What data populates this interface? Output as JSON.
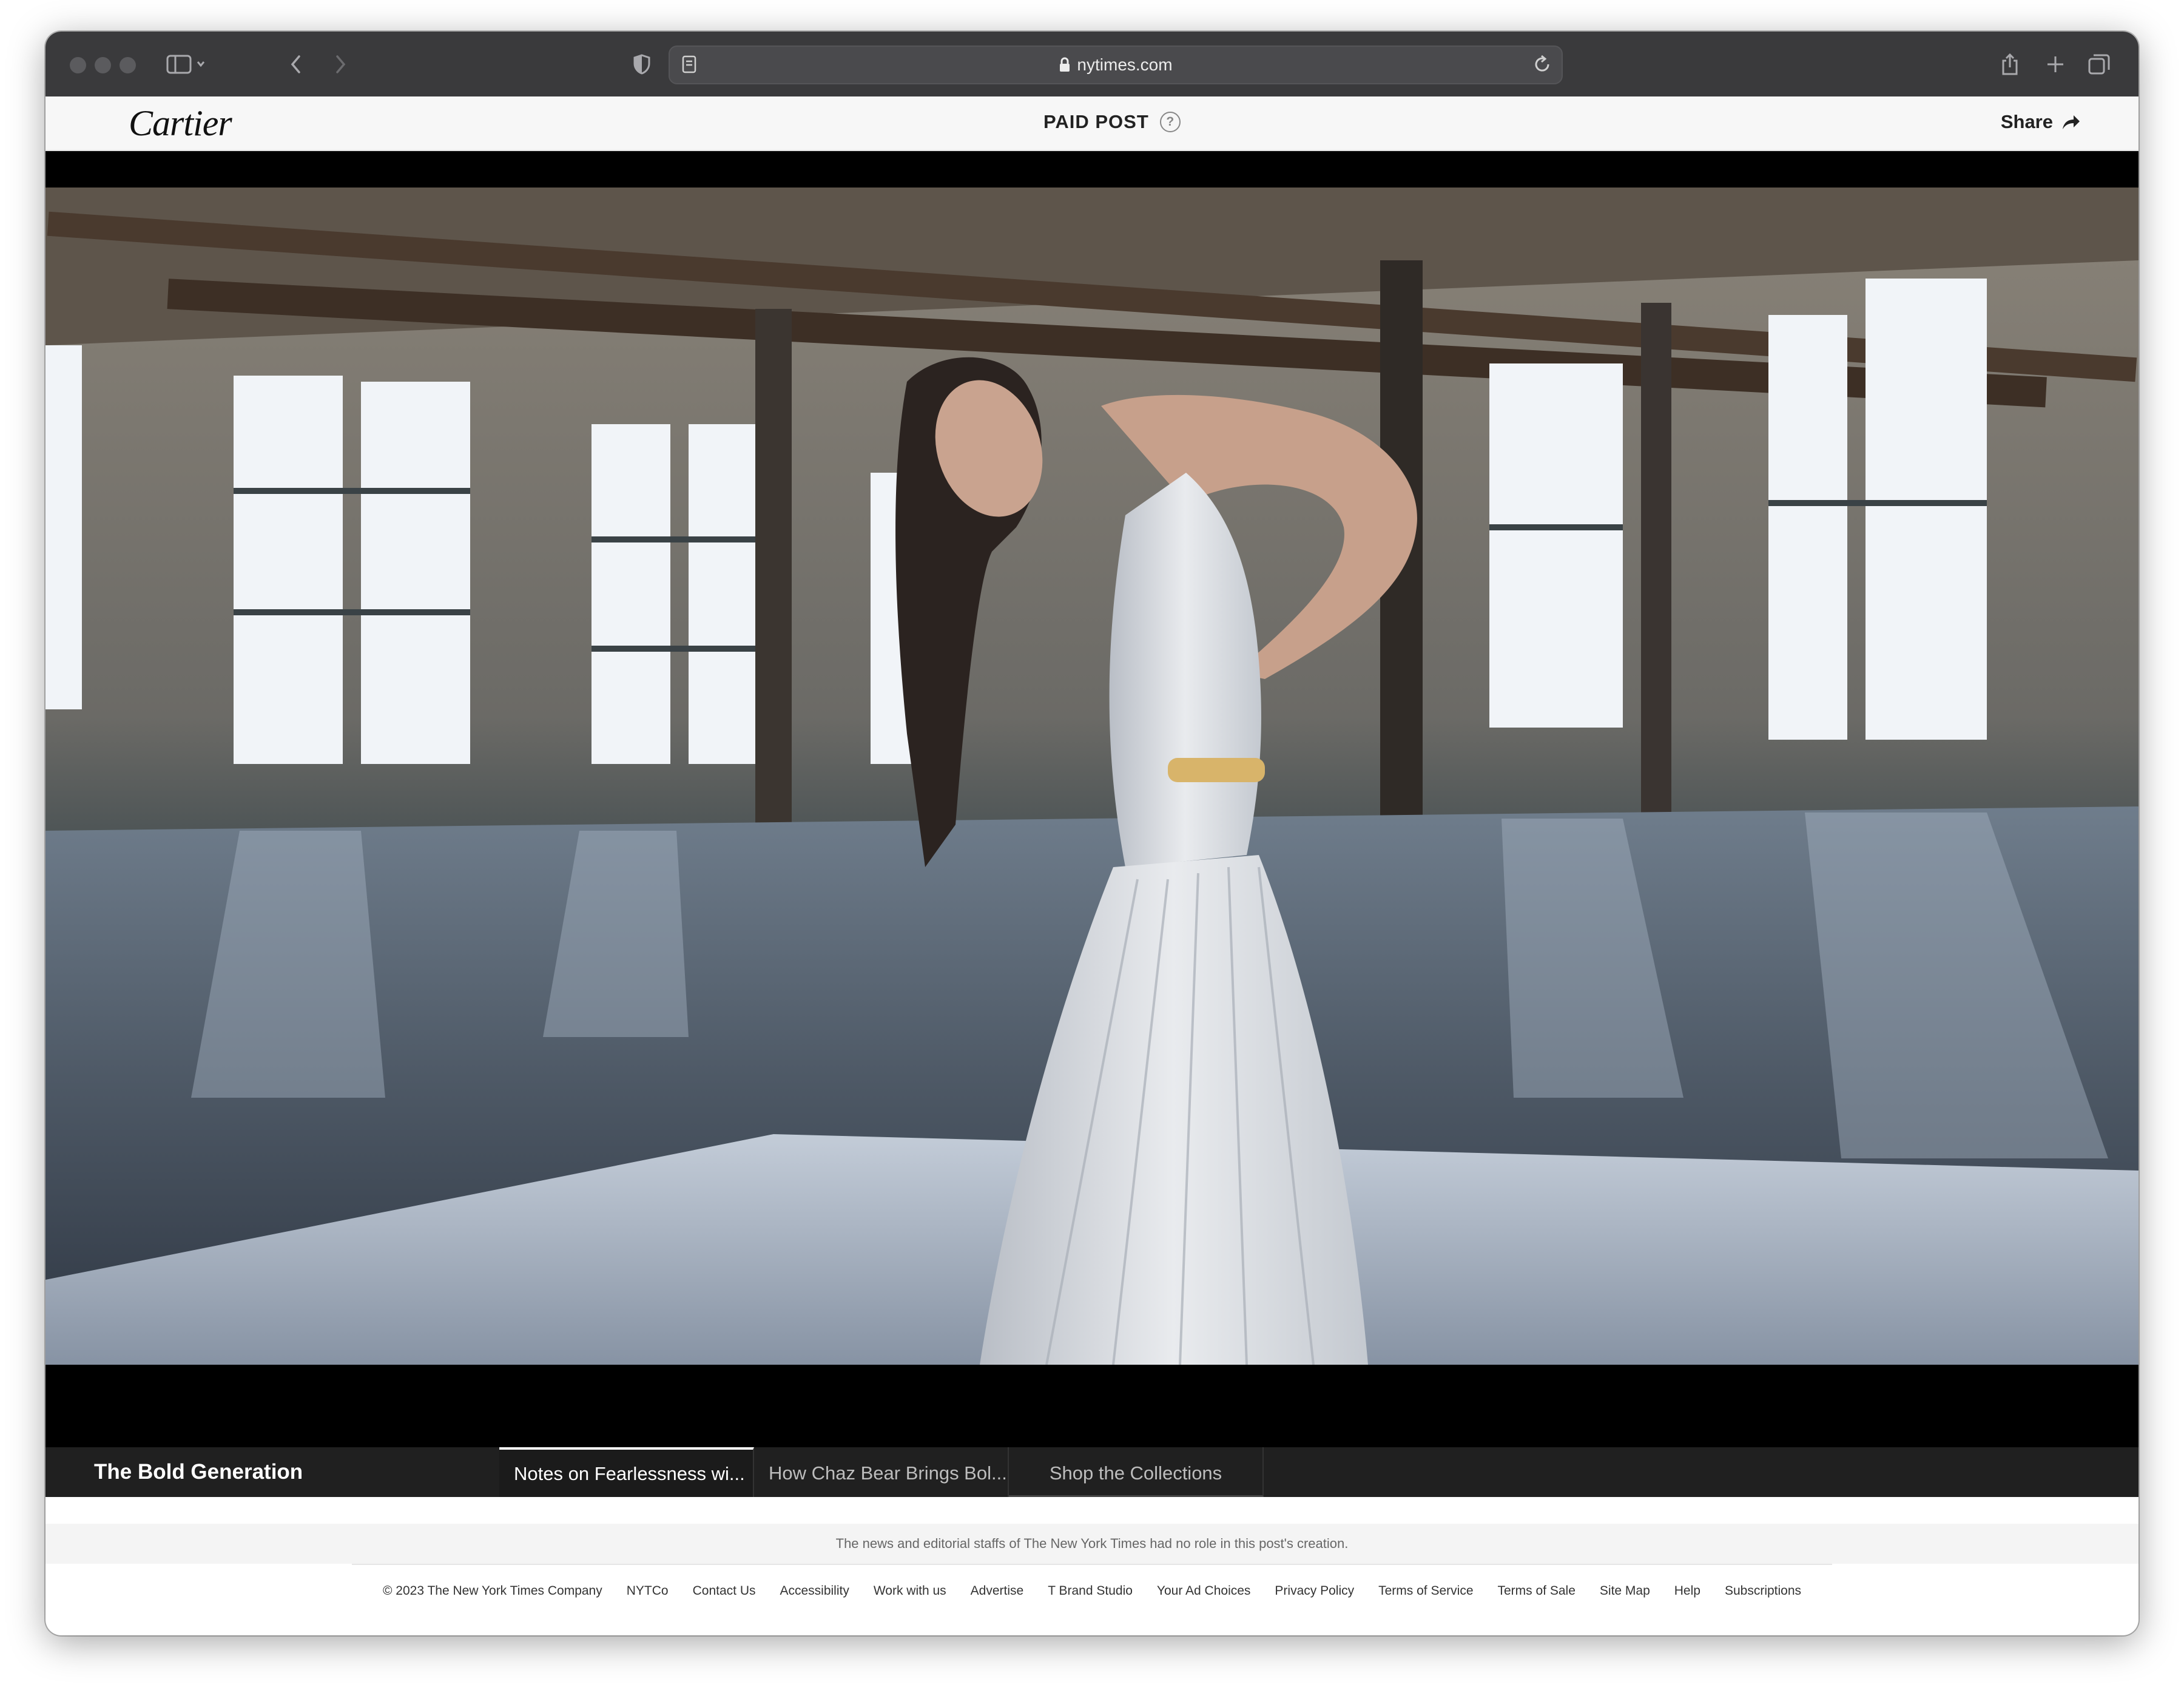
{
  "browser": {
    "url": "nytimes.com",
    "icons": {
      "sidebar": "sidebar-icon",
      "back": "chevron-left-icon",
      "forward": "chevron-right-icon",
      "shield": "shield-icon",
      "reader": "reader-icon",
      "lock": "lock-icon",
      "reload": "reload-icon",
      "share": "share-icon",
      "new_tab": "plus-icon",
      "tabs": "tabs-overview-icon"
    }
  },
  "ad_header": {
    "brand": "Cartier",
    "label": "PAID POST",
    "help": "?",
    "share": "Share"
  },
  "video_nav": {
    "series_title": "The Bold Generation",
    "tabs": [
      {
        "label": "Notes on Fearlessness wi...",
        "active": true
      },
      {
        "label": "How Chaz Bear Brings Bol...",
        "active": false
      },
      {
        "label": "Shop the Collections",
        "active": false
      }
    ]
  },
  "disclaimer": "The news and editorial staffs of The New York Times had no role in this post's creation.",
  "footer": {
    "links": [
      "© 2023 The New York Times Company",
      "NYTCo",
      "Contact Us",
      "Accessibility",
      "Work with us",
      "Advertise",
      "T Brand Studio",
      "Your Ad Choices",
      "Privacy Policy",
      "Terms of Service",
      "Terms of Sale",
      "Site Map",
      "Help",
      "Subscriptions"
    ]
  },
  "colors": {
    "toolbar": "#3a3a3c",
    "nav_bar": "#202020",
    "video_bg": "#000000"
  }
}
